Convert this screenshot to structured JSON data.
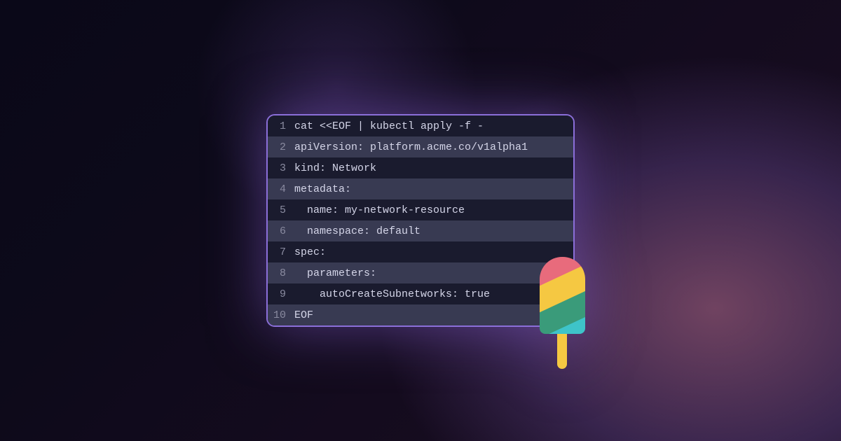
{
  "code": {
    "lines": [
      {
        "number": "1",
        "content": "cat <<EOF | kubectl apply -f -"
      },
      {
        "number": "2",
        "content": "apiVersion: platform.acme.co/v1alpha1"
      },
      {
        "number": "3",
        "content": "kind: Network"
      },
      {
        "number": "4",
        "content": "metadata:"
      },
      {
        "number": "5",
        "content": "  name: my-network-resource"
      },
      {
        "number": "6",
        "content": "  namespace: default"
      },
      {
        "number": "7",
        "content": "spec:"
      },
      {
        "number": "8",
        "content": "  parameters:"
      },
      {
        "number": "9",
        "content": "    autoCreateSubnetworks: true"
      },
      {
        "number": "10",
        "content": "EOF"
      }
    ]
  },
  "colors": {
    "border": "#8b6fd9",
    "background_dark": "#1a1b2e",
    "background_light": "#383a52",
    "text": "#d4d5e8",
    "line_number": "#8a8ba0"
  },
  "decoration": {
    "type": "popsicle-icon"
  }
}
